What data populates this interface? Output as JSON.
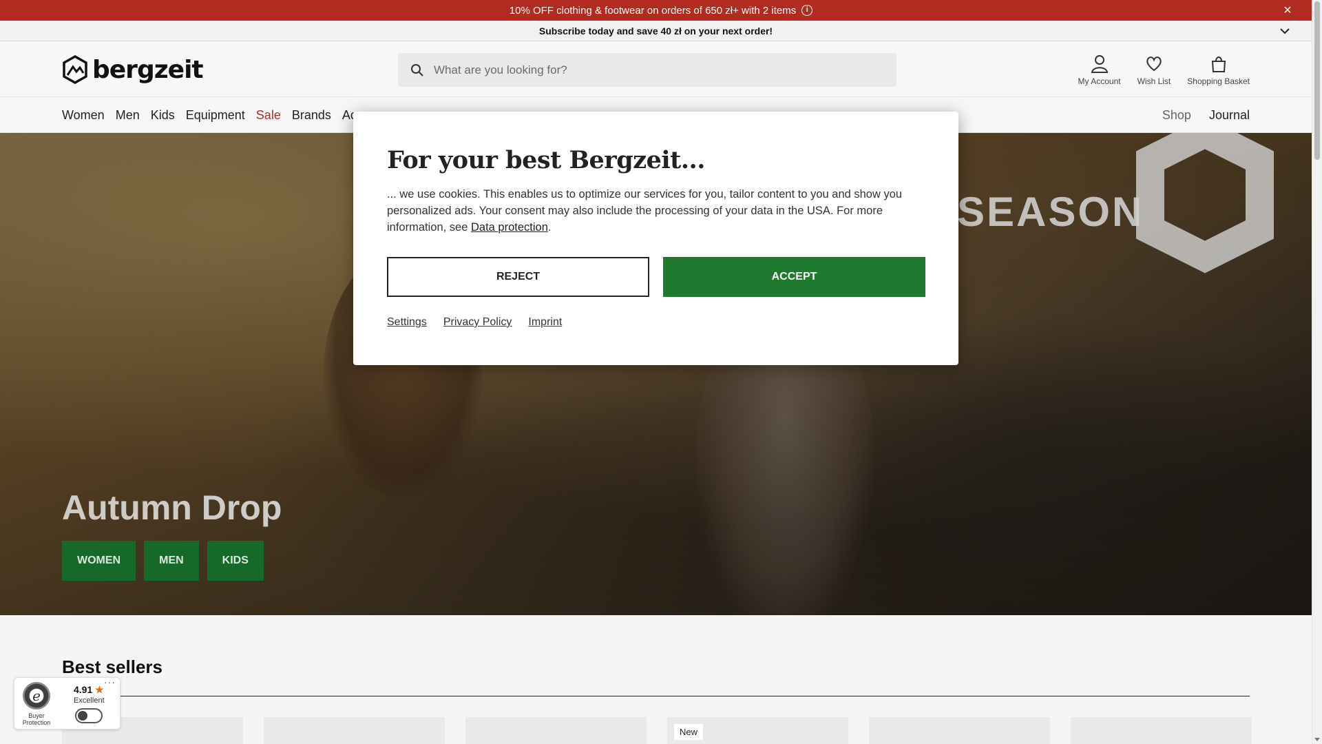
{
  "promo": {
    "text": "10% OFF clothing & footwear on orders of 650 zł+ with 2 items",
    "info_icon": "i",
    "close_icon": "×"
  },
  "subscribe": {
    "text": "Subscribe today and save 40 zł on your next order!"
  },
  "header": {
    "logo_text": "bergzeit",
    "search_placeholder": "What are you looking for?",
    "actions": {
      "account": "My Account",
      "wishlist": "Wish List",
      "basket": "Shopping Basket"
    }
  },
  "nav": {
    "items": [
      "Women",
      "Men",
      "Kids",
      "Equipment",
      "Sale",
      "Brands",
      "Ac..."
    ],
    "right": [
      "Shop",
      "Journal"
    ]
  },
  "hero": {
    "season_text": "SEASON",
    "title": "Autumn Drop",
    "buttons": [
      "WOMEN",
      "MEN",
      "KIDS"
    ]
  },
  "best_sellers": {
    "title": "Best sellers",
    "card_tag": "New"
  },
  "trust_badge": {
    "seal_letter": "e",
    "protection": "Buyer Protection",
    "score": "4.91",
    "star": "★",
    "label": "Excellent",
    "menu": "···"
  },
  "modal": {
    "title": "For your best Bergzeit...",
    "text_before_link": "... we use cookies. This enables us to optimize our services for you, tailor content to you and show you personalized ads. Your consent may also include the processing of your data in the USA. For more information, see ",
    "link": "Data protection",
    "text_after_link": ".",
    "reject": "REJECT",
    "accept": "ACCEPT",
    "links": [
      "Settings",
      "Privacy Policy",
      "Imprint"
    ]
  },
  "colors": {
    "promo_bg": "#b22b21",
    "accent_green": "#1f7a30",
    "sale_red": "#b22b21"
  }
}
